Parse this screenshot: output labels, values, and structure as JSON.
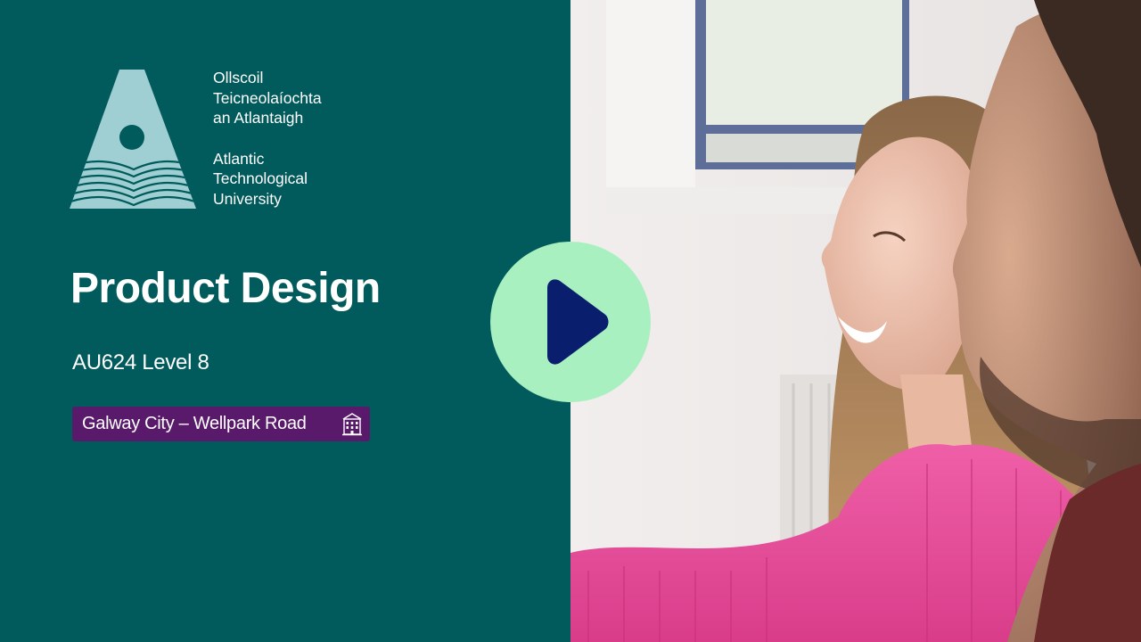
{
  "university": {
    "name_irish": [
      "Ollscoil",
      "Teicneolaíochta",
      "an Atlantaigh"
    ],
    "name_english": [
      "Atlantic",
      "Technological",
      "University"
    ],
    "logo_icon": "atu-triangle-logo"
  },
  "course": {
    "title": "Product Design",
    "code_level": "AU624 Level 8"
  },
  "campus": {
    "label": "Galway City – Wellpark Road",
    "icon": "building-icon"
  },
  "player": {
    "play_icon": "play-icon"
  },
  "colors": {
    "panel": "#015a5b",
    "play_button": "#a8f0c0",
    "play_triangle": "#0a1e6e",
    "badge": "#5a1a6b",
    "logo": "#9fcfd3"
  }
}
